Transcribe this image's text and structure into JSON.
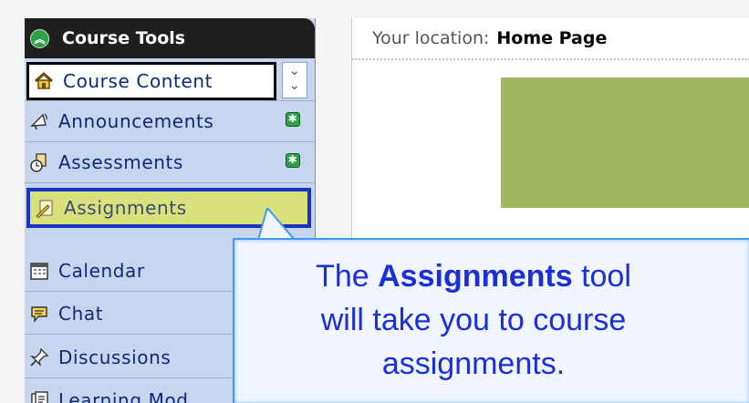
{
  "sidebar": {
    "header": {
      "title": "Course Tools",
      "collapse_icon": "chevron-up-circle-icon"
    },
    "items": [
      {
        "label": "Course Content",
        "icon": "house-icon",
        "selected": true,
        "dropdown_icon": "double-chevron-down-icon"
      },
      {
        "label": "Announcements",
        "icon": "megaphone-icon",
        "new": true
      },
      {
        "label": "Assessments",
        "icon": "stopwatch-icon",
        "new": true
      },
      {
        "label": "Assignments",
        "icon": "pencil-paper-icon",
        "highlighted": true
      },
      {
        "label": "Calendar",
        "icon": "calendar-icon"
      },
      {
        "label": "Chat",
        "icon": "speech-bubble-icon"
      },
      {
        "label": "Discussions",
        "icon": "pushpin-icon"
      },
      {
        "label": "Learning Mod",
        "icon": "document-stack-icon"
      }
    ]
  },
  "main": {
    "location_label": "Your location:",
    "location_value": "Home Page"
  },
  "callout": {
    "line1_before": "The",
    "line1_bold": "Assignments",
    "line1_after": "tool",
    "line2": "will take you to course",
    "line3": "assignments."
  },
  "colors": {
    "sidebar_bg": "#c8d5ee",
    "header_bg": "#1f1f1f",
    "highlight_bg": "#d9e27a",
    "highlight_border": "#1733c8",
    "green_block": "#a0b961",
    "callout_text": "#1a2fd6",
    "new_badge": "#2ea14a"
  }
}
